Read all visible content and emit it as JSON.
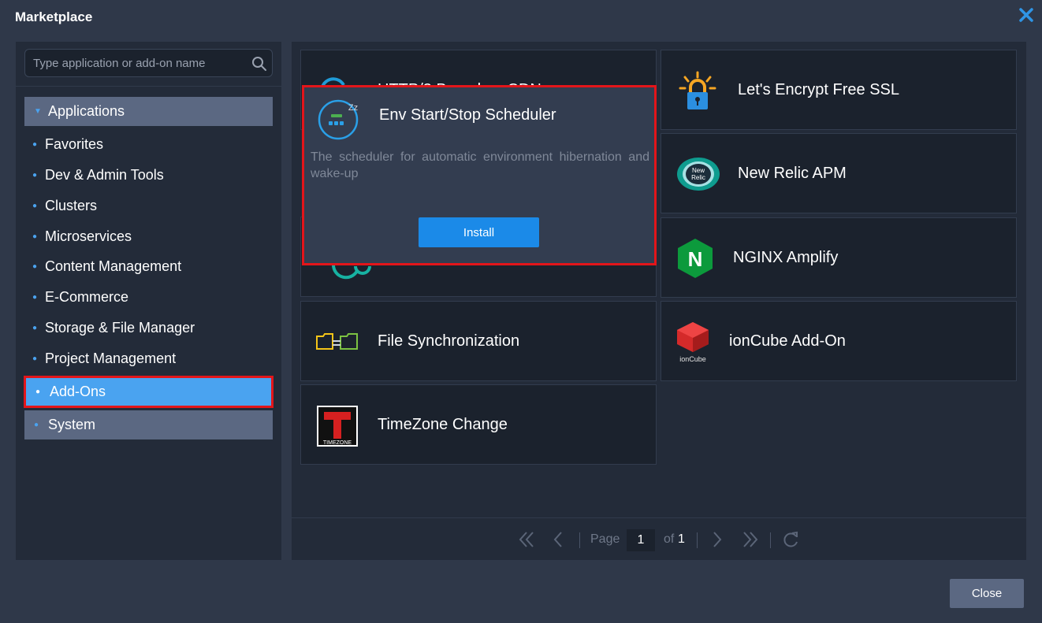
{
  "dialog": {
    "title": "Marketplace",
    "close_label": "Close"
  },
  "search": {
    "placeholder": "Type application or add-on name"
  },
  "sidebar": {
    "applications": "Applications",
    "sub_items": [
      "Favorites",
      "Dev & Admin Tools",
      "Clusters",
      "Microservices",
      "Content Management",
      "E-Commerce",
      "Storage & File Manager",
      "Project Management"
    ],
    "addons": "Add-Ons",
    "system": "System"
  },
  "tiles": {
    "hidden_1": "HTTP/3 Based on CDN",
    "letsencrypt": "Let's Encrypt Free SSL",
    "newrelic": "New Relic APM",
    "newrelic_logo_1": "New",
    "newrelic_logo_2": "Relic",
    "nginx": "NGINX Amplify",
    "nginx_logo": "N",
    "filesync": "File Synchronization",
    "ioncube": "ionCube Add-On",
    "ioncube_logo": "ionCube",
    "timezone": "TimeZone Change",
    "timezone_logo": "TIMEZONE"
  },
  "popup": {
    "title": "Env Start/Stop Scheduler",
    "description": "The scheduler for automatic environment hibernation and wake-up",
    "install_label": "Install",
    "icon_text": "Zz"
  },
  "pager": {
    "page_label": "Page",
    "page_value": "1",
    "of_label": "of",
    "total": "1"
  },
  "colors": {
    "accent": "#4aa3f0",
    "highlight": "#e3151a",
    "install": "#1b8ae8"
  }
}
